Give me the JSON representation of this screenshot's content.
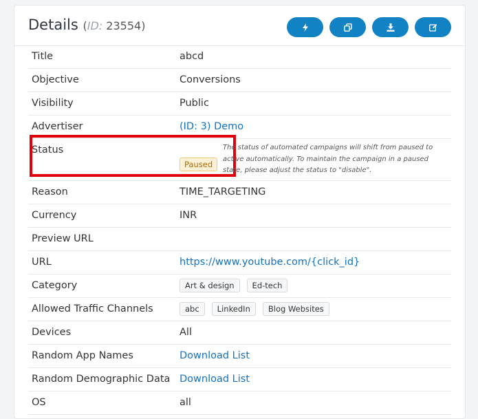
{
  "header": {
    "title": "Details",
    "id_label": "ID:",
    "id_value": "23554"
  },
  "actions": [
    {
      "icon": "lightning-icon"
    },
    {
      "icon": "copy-icon"
    },
    {
      "icon": "download-icon"
    },
    {
      "icon": "edit-icon"
    }
  ],
  "fields": {
    "title": {
      "label": "Title",
      "value": "abcd"
    },
    "objective": {
      "label": "Objective",
      "value": "Conversions"
    },
    "visibility": {
      "label": "Visibility",
      "value": "Public"
    },
    "advertiser": {
      "label": "Advertiser",
      "value": "(ID: 3) Demo"
    },
    "status": {
      "label": "Status",
      "value": "Paused",
      "note": "The status of automated campaigns will shift from paused to active automatically. To maintain the campaign in a paused state, please adjust the status to \"disable\"."
    },
    "reason": {
      "label": "Reason",
      "value": "TIME_TARGETING"
    },
    "currency": {
      "label": "Currency",
      "value": "INR"
    },
    "preview_url": {
      "label": "Preview URL",
      "value": ""
    },
    "url": {
      "label": "URL",
      "value": "https://www.youtube.com/{click_id}"
    },
    "category": {
      "label": "Category",
      "chips": [
        "Art & design",
        "Ed-tech"
      ]
    },
    "traffic": {
      "label": "Allowed Traffic Channels",
      "chips": [
        "abc",
        "LinkedIn",
        "Blog Websites"
      ]
    },
    "devices": {
      "label": "Devices",
      "value": "All"
    },
    "random_app_names": {
      "label": "Random App Names",
      "value": "Download List"
    },
    "random_demographic": {
      "label": "Random Demographic Data",
      "value": "Download List"
    },
    "os": {
      "label": "OS",
      "value": "all"
    }
  },
  "colors": {
    "accent": "#1183c4",
    "link": "#1172c2",
    "highlight": "#e0000c",
    "badge_bg": "#fdf1d6"
  }
}
